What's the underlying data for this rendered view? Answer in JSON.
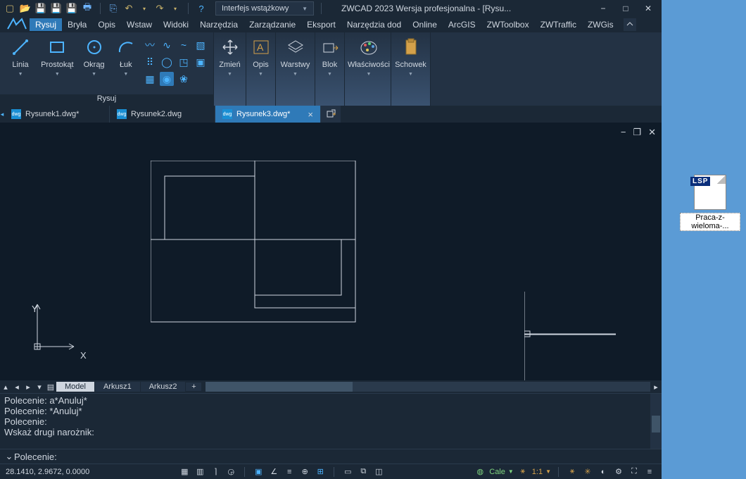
{
  "titlebar": {
    "mode_label": "Interfejs wstążkowy",
    "app_title": "ZWCAD 2023 Wersja profesjonalna - [Rysu..."
  },
  "menu": {
    "items": [
      "Rysuj",
      "Bryła",
      "Opis",
      "Wstaw",
      "Widoki",
      "Narzędzia",
      "Zarządzanie",
      "Eksport",
      "Narzędzia dod",
      "Online",
      "ArcGIS",
      "ZWToolbox",
      "ZWTraffic",
      "ZWGis"
    ],
    "active_index": 0
  },
  "ribbon": {
    "group_draw_title": "Rysuj",
    "buttons": {
      "line": "Linia",
      "rectangle": "Prostokąt",
      "circle": "Okrąg",
      "arc": "Łuk",
      "modify": "Zmień",
      "annotate": "Opis",
      "layers": "Warstwy",
      "block": "Blok",
      "properties": "Właściwości",
      "clipboard": "Schowek"
    }
  },
  "doctabs": {
    "tabs": [
      {
        "label": "Rysunek1.dwg*",
        "active": false
      },
      {
        "label": "Rysunek2.dwg",
        "active": false
      },
      {
        "label": "Rysunek3.dwg*",
        "active": true
      }
    ]
  },
  "viewport": {
    "axis_x": "X",
    "axis_y": "Y"
  },
  "layout": {
    "tabs": [
      "Model",
      "Arkusz1",
      "Arkusz2"
    ],
    "active_index": 0
  },
  "command": {
    "history": [
      "Polecenie: a*Anuluj*",
      "Polecenie: *Anuluj*",
      "Polecenie:",
      "Wskaż drugi narożnik:"
    ],
    "prompt": "Polecenie:"
  },
  "status": {
    "coords": "28.1410, 2.9672, 0.0000",
    "units": "Cale",
    "scale": "1:1"
  },
  "desktop": {
    "lsp_badge": "LSP",
    "filename": "Praca-z-wieloma-..."
  }
}
